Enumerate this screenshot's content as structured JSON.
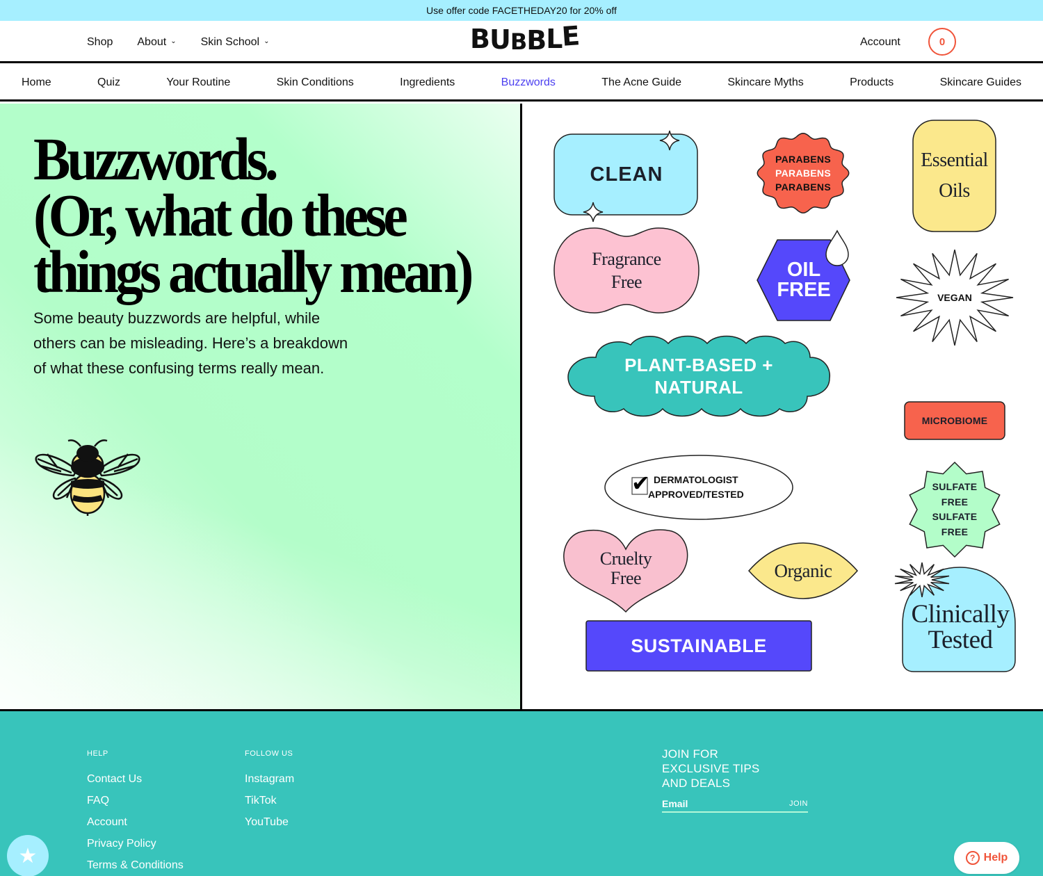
{
  "promo": {
    "text": "Use offer code FACETHEDAY20 for 20% off"
  },
  "header": {
    "logo": [
      "B",
      "U",
      "B",
      "B",
      "L",
      "E"
    ],
    "nav": [
      {
        "label": "Shop",
        "has_dropdown": false
      },
      {
        "label": "About",
        "has_dropdown": true
      },
      {
        "label": "Skin School",
        "has_dropdown": true
      }
    ],
    "chevron_glyph": "⌄",
    "account_label": "Account",
    "cart_count": "0"
  },
  "subnav": {
    "items": [
      "Home",
      "Quiz",
      "Your Routine",
      "Skin Conditions",
      "Ingredients",
      "Buzzwords",
      "The Acne Guide",
      "Skincare Myths",
      "Products",
      "Skincare Guides"
    ],
    "active": "Buzzwords"
  },
  "hero": {
    "title_lines": [
      "Buzzwords.",
      "(Or, what do these",
      "things actually mean)"
    ],
    "intro": "Some beauty buzzwords are helpful, while others can be misleading. Here’s a breakdown of what these confusing terms really mean.",
    "illustration": "bee-icon"
  },
  "badges": {
    "clean": {
      "lines": [
        "CLEAN"
      ],
      "color": "#a6efff"
    },
    "parabens": {
      "lines": [
        "PARABENS",
        "PARABENS",
        "PARABENS"
      ],
      "color": "#f7634d"
    },
    "essential_oils": {
      "lines": [
        "Essential",
        "Oils"
      ],
      "color": "#fbe88c"
    },
    "fragrance_free": {
      "lines": [
        "Fragrance",
        "Free"
      ],
      "color": "#fdc2d2"
    },
    "oil_free": {
      "lines": [
        "OIL",
        "FREE"
      ],
      "color": "#5548fb"
    },
    "vegan": {
      "lines": [
        "VEGAN"
      ],
      "color": "#ffffff"
    },
    "plant_based": {
      "lines": [
        "PLANT-BASED +",
        "NATURAL"
      ],
      "color": "#38c4bb"
    },
    "microbiome": {
      "lines": [
        "MICROBIOME"
      ],
      "color": "#f7634d"
    },
    "dermatologist": {
      "lines": [
        "DERMATOLOGIST",
        "APPROVED/TESTED"
      ],
      "color": "#ffffff",
      "check_glyph": "✔"
    },
    "sulfate_free": {
      "lines": [
        "SULFATE",
        "FREE",
        "SULFATE",
        "FREE"
      ],
      "color": "#b3fdc9"
    },
    "cruelty_free": {
      "lines": [
        "Cruelty",
        "Free"
      ],
      "color": "#f9c0cf"
    },
    "organic": {
      "lines": [
        "Organic"
      ],
      "color": "#fbe88c"
    },
    "sustainable": {
      "lines": [
        "SUSTAINABLE"
      ],
      "color": "#5548fb"
    },
    "clinically_tested": {
      "lines": [
        "Clinically",
        "Tested"
      ],
      "color": "#a6efff"
    }
  },
  "footer": {
    "help": {
      "heading": "HELP",
      "links": [
        "Contact Us",
        "FAQ",
        "Account",
        "Privacy Policy",
        "Terms & Conditions"
      ]
    },
    "follow": {
      "heading": "FOLLOW US",
      "links": [
        "Instagram",
        "TikTok",
        "YouTube"
      ]
    },
    "newsletter": {
      "title_lines": [
        "JOIN FOR",
        "EXCLUSIVE TIPS",
        "AND DEALS"
      ],
      "email_placeholder": "Email",
      "join_label": "JOIN"
    }
  },
  "widgets": {
    "rewards_icon": "star-icon",
    "rewards_glyph": "★",
    "help_label": "Help",
    "help_glyph": "?"
  },
  "colors": {
    "accent": "#4b3ff0",
    "cart": "#f0543a",
    "footer": "#38c4bb",
    "promo": "#a6efff"
  }
}
